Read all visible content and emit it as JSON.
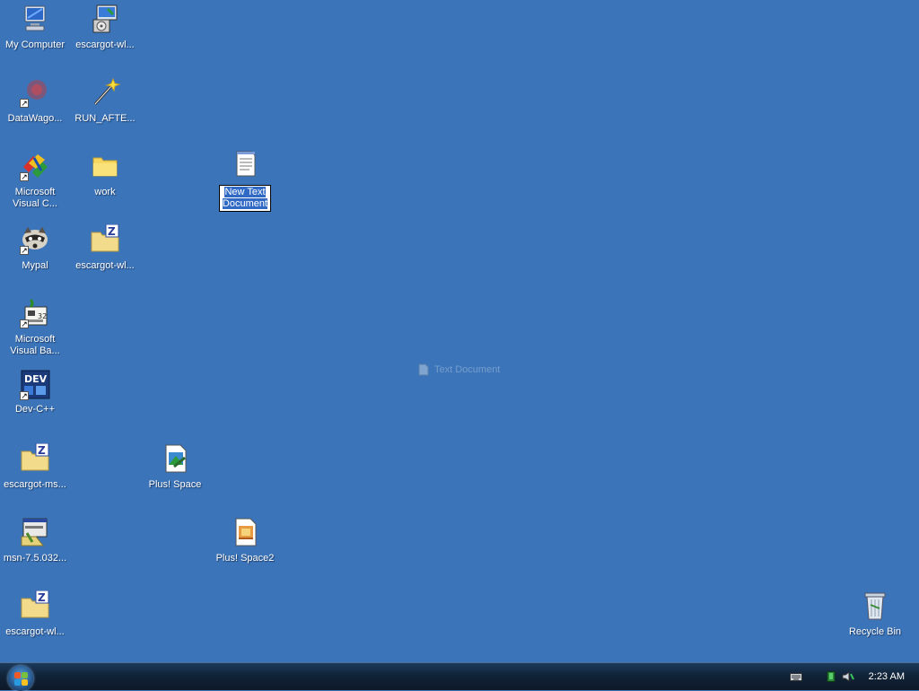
{
  "desktop": {
    "background_color": "#3b74b8",
    "icons": [
      {
        "label": "My Computer",
        "icon": "computer-icon"
      },
      {
        "label": "escargot-wl...",
        "icon": "installer-icon"
      },
      {
        "label": "DataWago...",
        "icon": "datawagon-icon",
        "shortcut": true
      },
      {
        "label": "RUN_AFTE...",
        "icon": "wand-icon"
      },
      {
        "label": "Microsoft Visual C...",
        "icon": "visual-c-icon",
        "shortcut": true
      },
      {
        "label": "work",
        "icon": "folder-icon"
      },
      {
        "label": "New Text Document",
        "icon": "text-document-icon",
        "renaming": true
      },
      {
        "label": "Mypal",
        "icon": "raccoon-icon",
        "shortcut": true
      },
      {
        "label": "escargot-wl...",
        "icon": "zip-folder-icon"
      },
      {
        "label": "Microsoft Visual Ba...",
        "icon": "visual-basic-icon",
        "shortcut": true
      },
      {
        "label": "Dev-C++",
        "icon": "dev-cpp-icon",
        "shortcut": true
      },
      {
        "label": "escargot-ms...",
        "icon": "zip-folder-icon"
      },
      {
        "label": "Plus! Space",
        "icon": "theme-file-icon"
      },
      {
        "label": "msn-7.5.032...",
        "icon": "setup-icon"
      },
      {
        "label": "Plus! Space2",
        "icon": "theme-file2-icon"
      },
      {
        "label": "escargot-wl...",
        "icon": "zip-folder-icon"
      },
      {
        "label": "Recycle Bin",
        "icon": "recycle-bin-icon"
      }
    ],
    "drag_ghost": {
      "label": "Text Document",
      "icon": "text-document-icon"
    }
  },
  "taskbar": {
    "start_button": "start-orb-icon",
    "tray_icons": [
      "keyboard-icon",
      "network-icon",
      "volume-icon"
    ],
    "clock": "2:23 AM"
  }
}
